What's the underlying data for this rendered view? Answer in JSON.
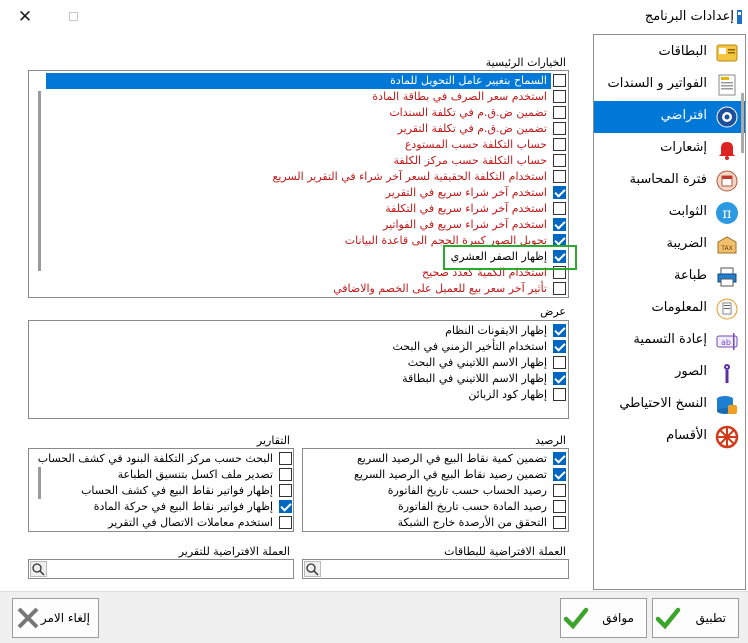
{
  "window": {
    "title": "إعدادات البرنامج"
  },
  "nav": {
    "items": [
      {
        "label": "البطاقات",
        "icon": "cards-icon"
      },
      {
        "label": "الفواتير و السندات",
        "icon": "bills-icon"
      },
      {
        "label": "افتراضي",
        "icon": "gear-icon",
        "selected": true
      },
      {
        "label": "إشعارات",
        "icon": "bell-icon"
      },
      {
        "label": "فترة المحاسبة",
        "icon": "calendar-icon"
      },
      {
        "label": "الثوابت",
        "icon": "pi-icon"
      },
      {
        "label": "الضريبة",
        "icon": "tax-icon"
      },
      {
        "label": "طباعة",
        "icon": "printer-icon"
      },
      {
        "label": "المعلومات",
        "icon": "info-icon"
      },
      {
        "label": "إعادة التسمية",
        "icon": "rename-icon"
      },
      {
        "label": "الصور",
        "icon": "image-icon"
      },
      {
        "label": "النسخ الاحتياطي",
        "icon": "database-backup-icon"
      },
      {
        "label": "الأقسام",
        "icon": "wheel-icon"
      }
    ]
  },
  "main_options": {
    "label": "الخيارات الرئيسية",
    "items": [
      {
        "text": "السماح بتغيير عامل التحويل للمادة",
        "checked": false,
        "red": false,
        "selected": true
      },
      {
        "text": "استخدم سعر الصرف في بطاقة المادة",
        "checked": false,
        "red": true
      },
      {
        "text": "تضمين ض.ق.م في تكلفة السندات",
        "checked": false,
        "red": true
      },
      {
        "text": "تضمين ض.ق.م في تكلفة التقرير",
        "checked": false,
        "red": true
      },
      {
        "text": "حساب التكلفة حسب المستودع",
        "checked": false,
        "red": true
      },
      {
        "text": "حساب التكلفة حسب مركز الكلفة",
        "checked": false,
        "red": true
      },
      {
        "text": "استخدام التكلفة الحقيقية لسعر آخر شراء في التقرير السريع",
        "checked": false,
        "red": true
      },
      {
        "text": "استخدم آخر شراء سريع في التقرير",
        "checked": true,
        "red": true
      },
      {
        "text": "استخدم آخر شراء سريع في التكلفة",
        "checked": false,
        "red": true
      },
      {
        "text": "استخدم آخر شراء سريع في الفواتير",
        "checked": true,
        "red": true
      },
      {
        "text": "تحويل الصور كبيرة الحجم الى قاعدة البيانات",
        "checked": true,
        "red": true
      },
      {
        "text": "إظهار الصفر العشري",
        "checked": true,
        "red": false
      },
      {
        "text": "استخدام الكمية كعدد صحيح",
        "checked": false,
        "red": true
      },
      {
        "text": "تأثير آخر سعر بيع للعميل على الخصم والاضافي",
        "checked": false,
        "red": true
      }
    ]
  },
  "view": {
    "label": "عرض",
    "items": [
      {
        "text": "إظهار الايقونات النظام",
        "checked": true
      },
      {
        "text": "استخدام التأخير الزمني في البحث",
        "checked": true
      },
      {
        "text": "إظهار الاسم اللاتيني في البحث",
        "checked": false
      },
      {
        "text": "إظهار الاسم اللاتيني في البطاقة",
        "checked": true
      },
      {
        "text": "إظهار كود الزبائن",
        "checked": false
      }
    ]
  },
  "balance": {
    "label": "الرصيد",
    "items": [
      {
        "text": "تضمين كمية نقاط البيع في الرصيد السريع",
        "checked": true
      },
      {
        "text": "تضمين رصيد نقاط البيع في الرصيد السريع",
        "checked": true
      },
      {
        "text": "رصيد الحساب حسب تاريخ الفاتورة",
        "checked": false
      },
      {
        "text": "رصيد المادة حسب تاريخ الفاتورة",
        "checked": false
      },
      {
        "text": "التحقق من الأرصدة خارج الشبكة",
        "checked": false
      }
    ]
  },
  "reports": {
    "label": "التقارير",
    "items": [
      {
        "text": "البحث حسب مركز التكلفة البنود في كشف الحساب",
        "checked": false
      },
      {
        "text": "تصدير ملف اكسل بتنسيق الطباعة",
        "checked": false
      },
      {
        "text": "إظهار فواتير نقاط البيع في كشف الحساب",
        "checked": false
      },
      {
        "text": "إظهار فواتير نقاط البيع في حركة المادة",
        "checked": true
      },
      {
        "text": "استخدم معاملات الاتصال في التقرير",
        "checked": false
      }
    ]
  },
  "default_currency_cards": {
    "label": "العملة الافتراضية للبطاقات",
    "value": ""
  },
  "default_currency_report": {
    "label": "العملة الافتراضية للتقرير",
    "value": ""
  },
  "buttons": {
    "apply": "تطبيق",
    "ok": "موافق",
    "cancel": "إلغاء الامر"
  },
  "colors": {
    "accent": "#0078d7",
    "check": "#0067c0",
    "red_text": "#c01818",
    "highlight_border": "#2bab2b"
  }
}
